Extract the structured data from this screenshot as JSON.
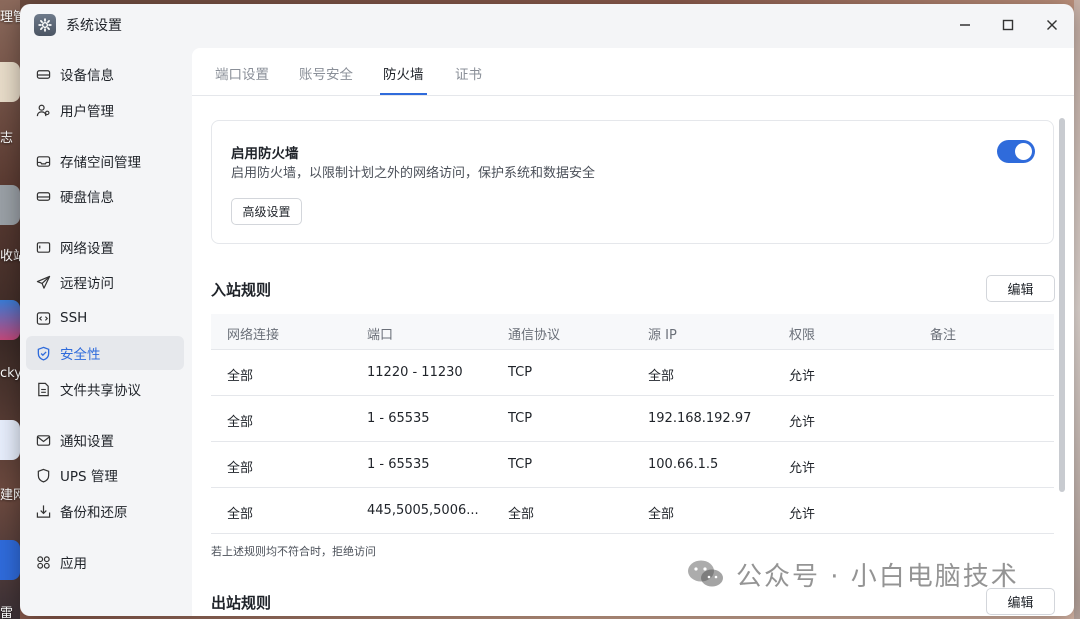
{
  "window": {
    "title": "系统设置"
  },
  "background": {
    "fragments": [
      "理管",
      "志",
      "收站",
      "cky",
      "建网",
      "雷"
    ]
  },
  "sidebar": {
    "items": [
      {
        "label": "设备信息",
        "icon": "drive-icon"
      },
      {
        "label": "用户管理",
        "icon": "users-icon"
      },
      {
        "label": "存储空间管理",
        "icon": "storage-icon"
      },
      {
        "label": "硬盘信息",
        "icon": "disk-icon"
      },
      {
        "label": "网络设置",
        "icon": "network-icon"
      },
      {
        "label": "远程访问",
        "icon": "send-icon"
      },
      {
        "label": "SSH",
        "icon": "code-icon"
      },
      {
        "label": "安全性",
        "icon": "shield-check-icon",
        "active": true
      },
      {
        "label": "文件共享协议",
        "icon": "file-icon"
      },
      {
        "label": "通知设置",
        "icon": "mail-icon"
      },
      {
        "label": "UPS 管理",
        "icon": "shield-icon"
      },
      {
        "label": "备份和还原",
        "icon": "backup-icon"
      },
      {
        "label": "应用",
        "icon": "apps-icon"
      }
    ]
  },
  "tabs": [
    {
      "label": "端口设置"
    },
    {
      "label": "账号安全"
    },
    {
      "label": "防火墙",
      "active": true
    },
    {
      "label": "证书"
    }
  ],
  "firewall": {
    "title": "启用防火墙",
    "description": "启用防火墙，以限制计划之外的网络访问，保护系统和数据安全",
    "enabled": true,
    "advanced_label": "高级设置"
  },
  "inbound": {
    "title": "入站规则",
    "edit_label": "编辑",
    "columns": [
      "网络连接",
      "端口",
      "通信协议",
      "源 IP",
      "权限",
      "备注"
    ],
    "rows": [
      [
        "全部",
        "11220 - 11230",
        "TCP",
        "全部",
        "允许",
        ""
      ],
      [
        "全部",
        "1 - 65535",
        "TCP",
        "192.168.192.97",
        "允许",
        ""
      ],
      [
        "全部",
        "1 - 65535",
        "TCP",
        "100.66.1.5",
        "允许",
        ""
      ],
      [
        "全部",
        "445,5005,5006...",
        "全部",
        "全部",
        "允许",
        ""
      ]
    ],
    "footnote": "若上述规则均不符合时，拒绝访问"
  },
  "outbound": {
    "title": "出站规则",
    "edit_label": "编辑"
  },
  "watermark": {
    "text": "公众号 · 小白电脑技术"
  },
  "colors": {
    "accent": "#2f6bdb"
  }
}
